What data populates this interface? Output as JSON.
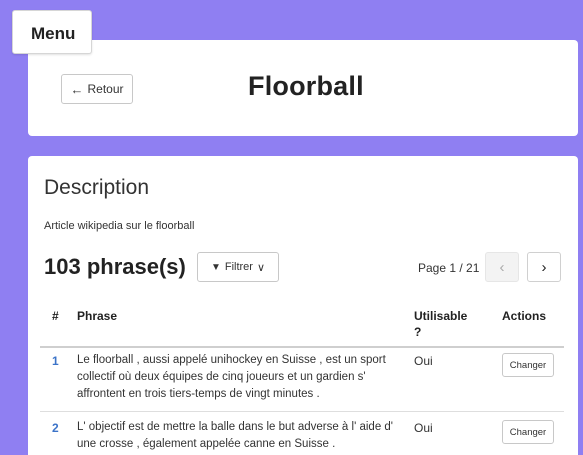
{
  "menu": {
    "label": "Menu"
  },
  "header": {
    "back_label": "Retour",
    "back_icon": "←",
    "title": "Floorball"
  },
  "description": {
    "heading": "Description",
    "text": "Article wikipedia sur le floorball"
  },
  "toolbar": {
    "count": "103 phrase(s)",
    "filter_label": "Filtrer",
    "filter_icon": "▼",
    "filter_chevron": "∨",
    "page_info": "Page 1 / 21",
    "prev_icon": "‹",
    "next_icon": "›"
  },
  "table": {
    "headers": {
      "num": "#",
      "phrase": "Phrase",
      "usable": "Utilisable ?",
      "actions": "Actions"
    },
    "rows": [
      {
        "num": "1",
        "phrase_lines": [
          "Le floorball , aussi appelé unihockey en Suisse , est un sport",
          "collectif où deux équipes de cinq joueurs et un gardien s'",
          "affrontent en trois tiers-temps de vingt minutes ."
        ],
        "usable": "Oui",
        "action": "Changer"
      },
      {
        "num": "2",
        "phrase_lines": [
          "L' objectif est de mettre la balle dans le but adverse à l' aide d'",
          "une crosse , également appelée canne en Suisse ."
        ],
        "usable": "Oui",
        "action": "Changer"
      }
    ]
  }
}
